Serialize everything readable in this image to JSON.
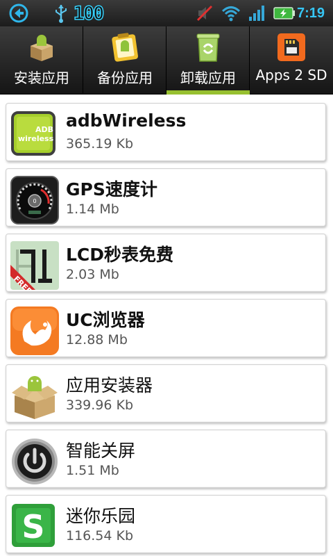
{
  "status_bar": {
    "battery_text": "100",
    "time": "7:19",
    "icons": [
      "back-arrow-icon",
      "usb-icon",
      "mute-icon",
      "wifi-icon",
      "signal-icon",
      "battery-charging-icon"
    ]
  },
  "tabs": [
    {
      "label": "安装应用",
      "icon": "install-box-icon",
      "selected": false
    },
    {
      "label": "备份应用",
      "icon": "backup-clipboard-icon",
      "selected": false
    },
    {
      "label": "卸载应用",
      "icon": "uninstall-trash-icon",
      "selected": true
    },
    {
      "label": "Apps 2 SD",
      "icon": "sd-card-icon",
      "selected": false
    }
  ],
  "apps": [
    {
      "name": "adbWireless",
      "size": "365.19 Kb",
      "icon": "adb-wireless-icon"
    },
    {
      "name": "GPS速度计",
      "size": "1.14 Mb",
      "icon": "speedometer-icon"
    },
    {
      "name": "LCD秒表免费",
      "size": "2.03 Mb",
      "icon": "lcd-stopwatch-icon",
      "badge": "FREE"
    },
    {
      "name": "UC浏览器",
      "size": "12.88 Mb",
      "icon": "uc-browser-icon"
    },
    {
      "name": "应用安装器",
      "size": "339.96 Kb",
      "icon": "app-installer-icon"
    },
    {
      "name": "智能关屏",
      "size": "1.51 Mb",
      "icon": "power-button-icon"
    },
    {
      "name": "迷你乐园",
      "size": "116.54 Kb",
      "icon": "mini-park-icon",
      "icon_letter": "S"
    }
  ],
  "colors": {
    "tab_indicator": "#97c030",
    "status_accent": "#36c6f4"
  }
}
